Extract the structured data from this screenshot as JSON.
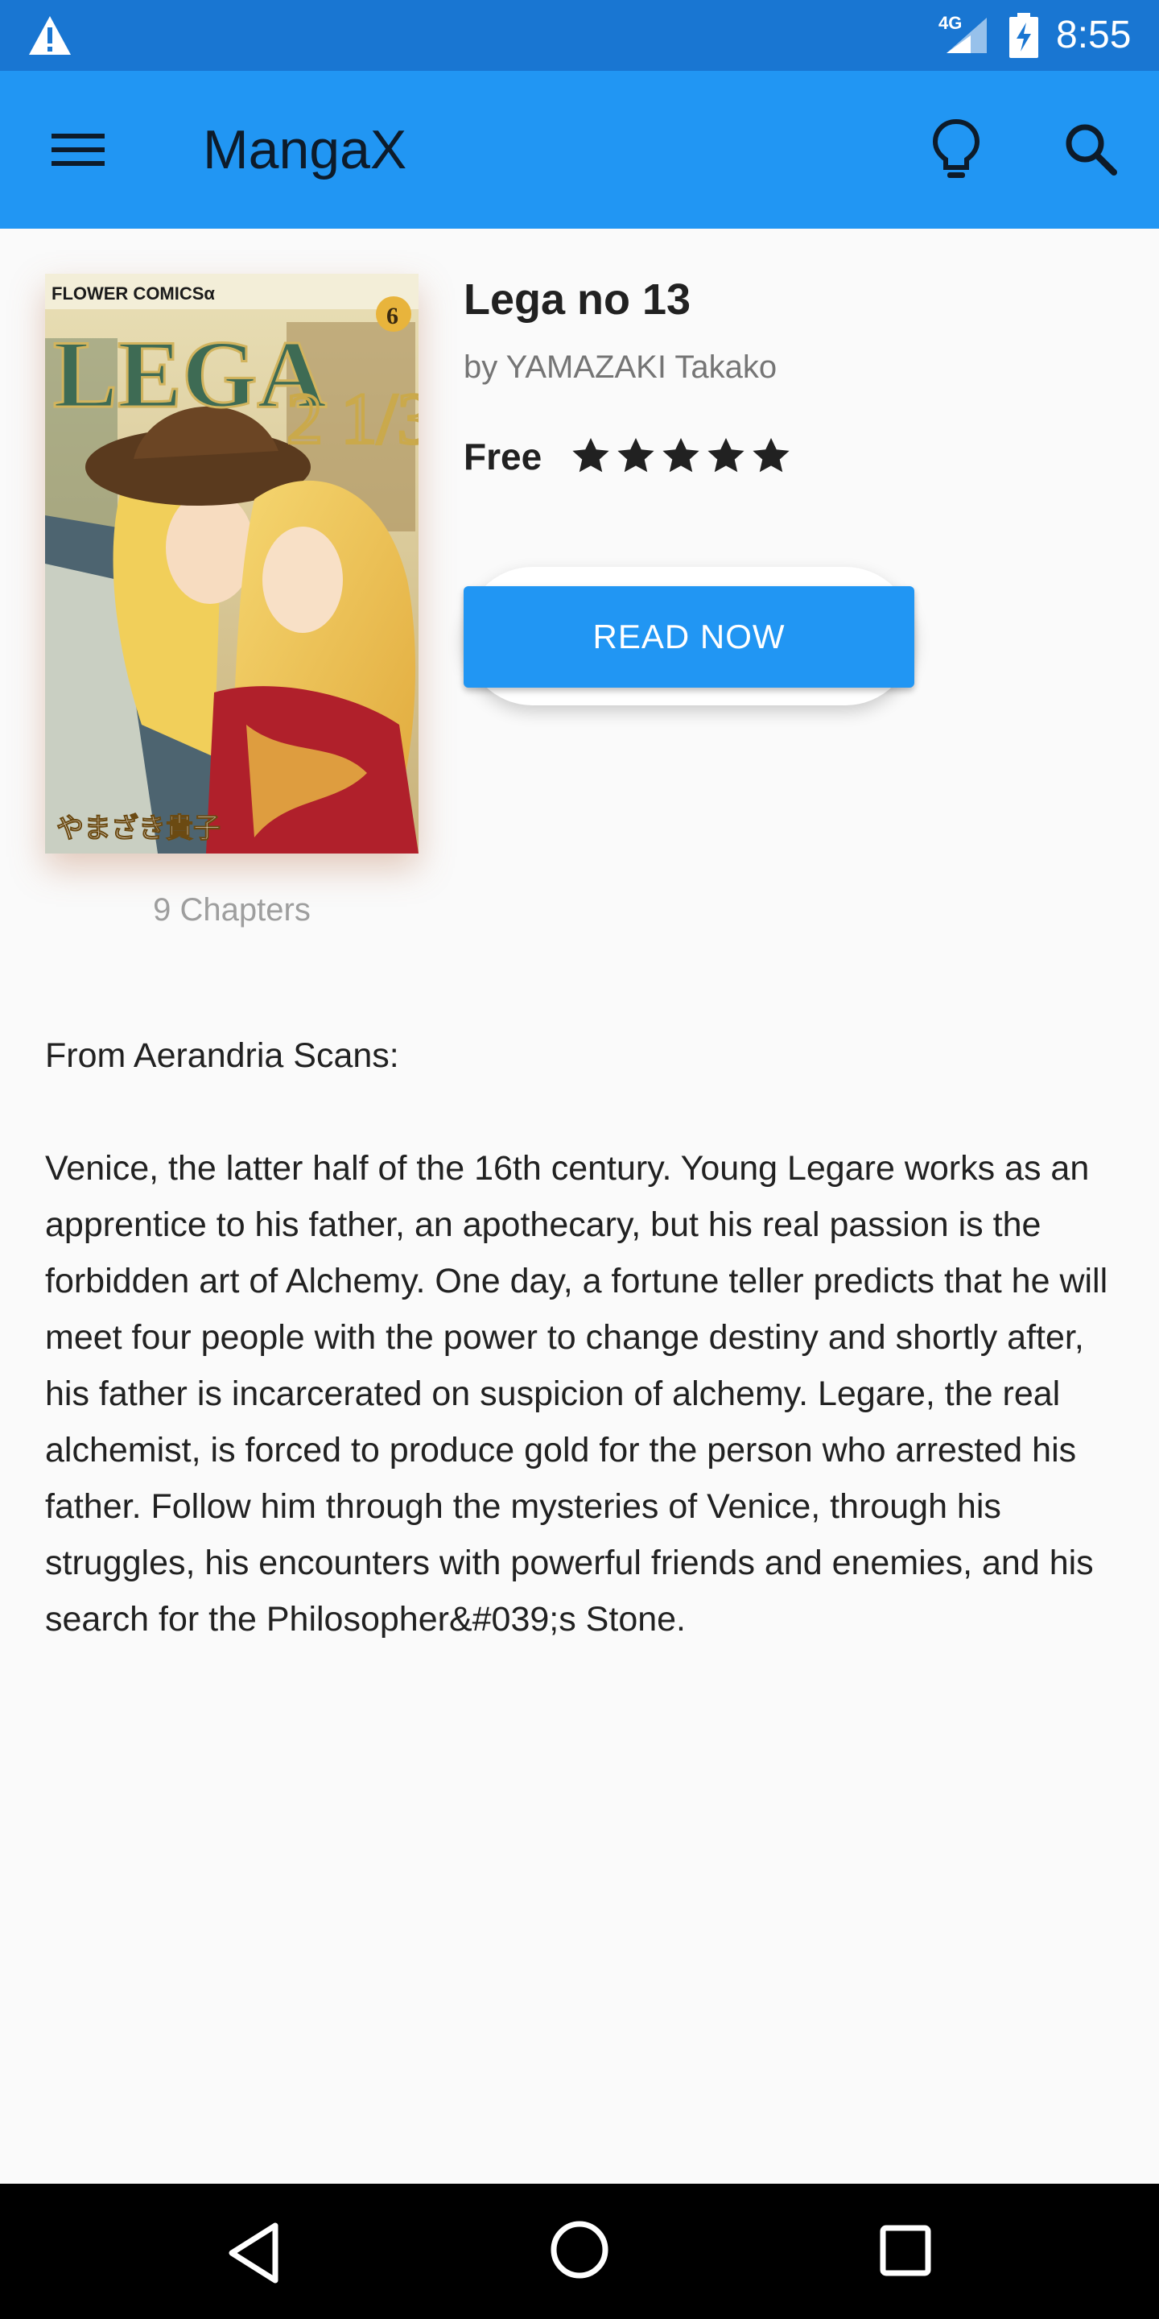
{
  "status_bar": {
    "network": "4G",
    "time": "8:55",
    "icons": [
      "alert-icon",
      "signal-icon",
      "battery-charging-icon"
    ]
  },
  "app_bar": {
    "title": "MangaX",
    "icons": [
      "menu-icon",
      "lightbulb-icon",
      "search-icon"
    ],
    "color": "#2196f3"
  },
  "manga": {
    "title": "Lega no 13",
    "author": "by YAMAZAKI Takako",
    "price": "Free",
    "rating": 5,
    "rating_max": 5,
    "chapters": "9 Chapters",
    "read_label": "READ NOW",
    "cover_texts": {
      "publisher": "FLOWER COMICSα",
      "logo": "LEGA",
      "logo_fraction": "2 1/3",
      "volume": "6",
      "author_jp": "やまざき貴子"
    }
  },
  "description": {
    "intro": "From Aerandria Scans:",
    "body": "Venice, the latter half of the 16th century. Young Legare works as an apprentice to his father, an apothecary, but his real passion is the forbidden art of Alchemy. One day, a fortune teller predicts that he will meet four people with the power to change destiny and shortly after, his father is incarcerated on suspicion of alchemy. Legare, the real alchemist, is forced to produce gold for the person who arrested his father. Follow him through the mysteries of Venice, through his struggles, his encounters with powerful friends and enemies, and his search for the Philosopher&#039;s Stone."
  },
  "nav_bar": {
    "icons": [
      "back-icon",
      "home-icon",
      "recents-icon"
    ]
  }
}
